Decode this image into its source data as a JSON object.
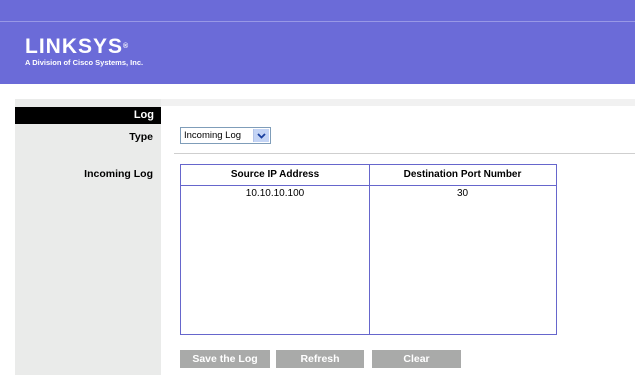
{
  "brand": {
    "logo_text": "LINKSYS",
    "registered_mark": "®",
    "tagline": "A Division of Cisco Systems, Inc."
  },
  "section": {
    "title": "Log",
    "type_label": "Type",
    "incoming_log_label": "Incoming Log"
  },
  "type_select": {
    "value": "Incoming Log",
    "icon": "chevron-down-icon"
  },
  "table": {
    "columns": [
      "Source IP Address",
      "Destination Port Number"
    ],
    "rows": [
      [
        "10.10.10.100",
        "30"
      ]
    ]
  },
  "buttons": {
    "save": "Save the Log",
    "refresh": "Refresh",
    "clear": "Clear"
  },
  "colors": {
    "header": "#6b6bd8",
    "table_border": "#6666cc",
    "button": "#a9aaa9",
    "sidebar": "#eaebea"
  }
}
